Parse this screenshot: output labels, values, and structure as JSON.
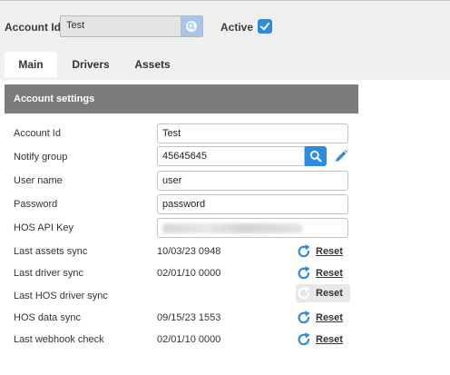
{
  "header": {
    "account_label": "Account Id",
    "account_value": "Test",
    "active_label": "Active",
    "active_checked": true
  },
  "tabs": [
    {
      "label": "Main",
      "active": true
    },
    {
      "label": "Drivers",
      "active": false
    },
    {
      "label": "Assets",
      "active": false
    }
  ],
  "panel": {
    "title": "Account settings",
    "fields": {
      "account_id": {
        "label": "Account Id",
        "value": "Test"
      },
      "notify_group": {
        "label": "Notify group",
        "value": "45645645"
      },
      "user_name": {
        "label": "User name",
        "value": "user"
      },
      "password": {
        "label": "Password",
        "value": "password"
      },
      "hos_api_key": {
        "label": "HOS API Key",
        "value": ""
      }
    },
    "syncs": {
      "last_assets_sync": {
        "label": "Last assets sync",
        "value": "10/03/23 0948",
        "action": "Reset"
      },
      "last_driver_sync": {
        "label": "Last driver sync",
        "value": "02/01/10 0000",
        "action": "Reset"
      },
      "last_hos_driver_sync": {
        "label": "Last HOS driver sync",
        "value": "",
        "action": "Reset"
      },
      "hos_data_sync": {
        "label": "HOS data sync",
        "value": "09/15/23 1553",
        "action": "Reset"
      },
      "last_webhook_check": {
        "label": "Last webhook check",
        "value": "02/01/10 0000",
        "action": "Reset"
      }
    }
  },
  "colors": {
    "accent": "#2f8be0",
    "panel_header": "#7b7b7b",
    "topbar": "#f0f0f0"
  },
  "icons": {
    "account_picker": "search-icon",
    "active_checkbox": "check-icon",
    "notify_search": "search-icon",
    "notify_edit": "pencil-icon",
    "reset": "refresh-icon"
  }
}
